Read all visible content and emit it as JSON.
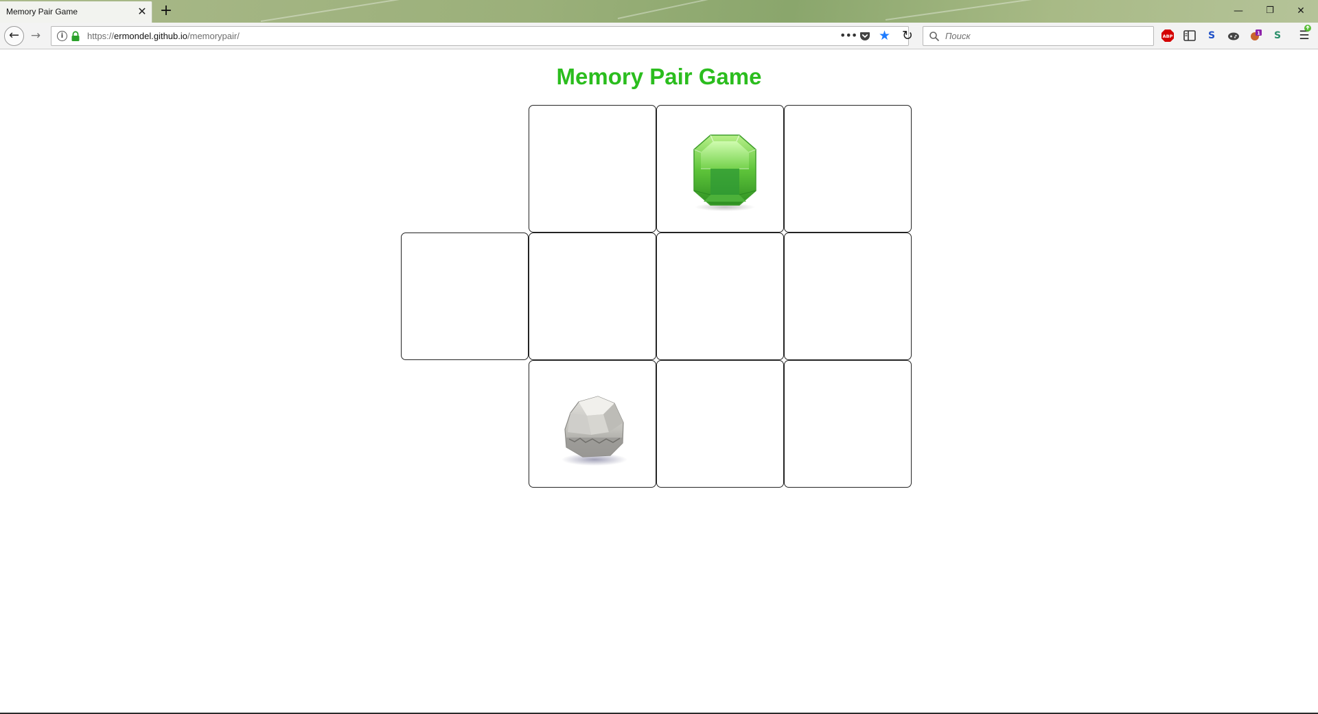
{
  "browser": {
    "tab": {
      "title": "Memory Pair Game",
      "close_glyph": "✕"
    },
    "new_tab_glyph": "+",
    "window_controls": {
      "minimize": "—",
      "restore": "❐",
      "close": "✕"
    },
    "nav": {
      "back_glyph": "←",
      "forward_glyph": "→",
      "reload_glyph": "↻"
    },
    "url": {
      "scheme": "https://",
      "host": "ermondel.github.io",
      "path": "/memorypair/",
      "page_actions_glyph": "•••",
      "bookmark_glyph": "★"
    },
    "search": {
      "placeholder": "Поиск"
    },
    "extensions": [
      {
        "name": "adblock-plus-icon",
        "label": "ABP",
        "color": "#d40000"
      },
      {
        "name": "sidebar-icon",
        "label": "",
        "color": "#333333"
      },
      {
        "name": "s-extension-icon",
        "label": "S",
        "color": "#1e50c8"
      },
      {
        "name": "gamepad-extension-icon",
        "label": "",
        "color": "#444444"
      },
      {
        "name": "notification-extension-icon",
        "label": "1",
        "color": "#8b1fa8"
      },
      {
        "name": "s-green-extension-icon",
        "label": "S",
        "color": "#2a8f6a"
      }
    ],
    "menu_glyph": "☰"
  },
  "game": {
    "title": "Memory Pair Game",
    "title_color": "#2bbd1e",
    "cards": [
      {
        "id": "card-r1-c2",
        "state": "face-down",
        "icon": ""
      },
      {
        "id": "card-r1-c3",
        "state": "face-up",
        "icon": "green-gem-icon"
      },
      {
        "id": "card-r1-c4",
        "state": "face-down",
        "icon": ""
      },
      {
        "id": "card-r2-c1",
        "state": "face-down",
        "icon": ""
      },
      {
        "id": "card-r2-c2",
        "state": "face-down",
        "icon": ""
      },
      {
        "id": "card-r2-c3",
        "state": "face-down",
        "icon": ""
      },
      {
        "id": "card-r2-c4",
        "state": "face-down",
        "icon": ""
      },
      {
        "id": "card-r3-c2",
        "state": "face-up",
        "icon": "gray-rock-icon"
      },
      {
        "id": "card-r3-c3",
        "state": "face-down",
        "icon": ""
      },
      {
        "id": "card-r3-c4",
        "state": "face-down",
        "icon": ""
      }
    ]
  }
}
